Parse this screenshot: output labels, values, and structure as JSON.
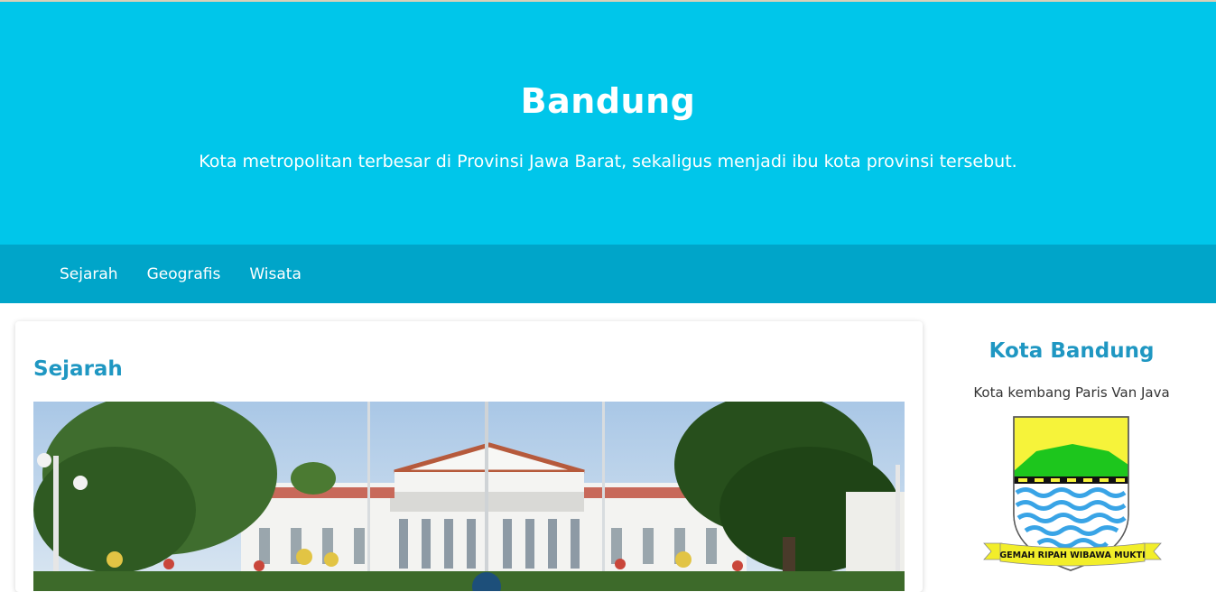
{
  "header": {
    "title": "Bandung",
    "subtitle": "Kota metropolitan terbesar di Provinsi Jawa Barat, sekaligus menjadi ibu kota provinsi tersebut."
  },
  "nav": {
    "items": [
      "Sejarah",
      "Geografis",
      "Wisata"
    ]
  },
  "article": {
    "heading": "Sejarah"
  },
  "sidebar": {
    "heading": "Kota Bandung",
    "tagline": "Kota kembang Paris Van Java",
    "crest_motto": "GEMAH RIPAH WIBAWA MUKTI"
  },
  "colors": {
    "header_bg": "#00c6ea",
    "nav_bg": "#00a5c9",
    "heading_accent": "#1f97c2"
  }
}
